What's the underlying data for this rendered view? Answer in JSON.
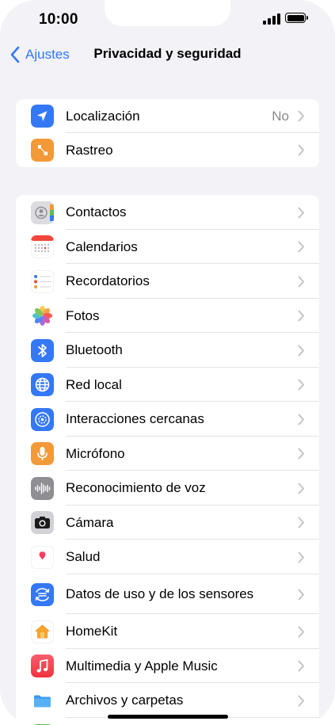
{
  "status_bar": {
    "time": "10:00"
  },
  "nav": {
    "back_label": "Ajustes",
    "title": "Privacidad y seguridad"
  },
  "group1": [
    {
      "label": "Localización",
      "value": "No",
      "icon": "location-arrow-icon",
      "color": "#3478f6"
    },
    {
      "label": "Rastreo",
      "value": "",
      "icon": "tracking-icon",
      "color": "#f19a37"
    }
  ],
  "group2": [
    {
      "label": "Contactos",
      "icon": "contacts-icon",
      "color": "#d9d9de"
    },
    {
      "label": "Calendarios",
      "icon": "calendar-icon",
      "color": "#ffffff"
    },
    {
      "label": "Recordatorios",
      "icon": "reminders-icon",
      "color": "#ffffff"
    },
    {
      "label": "Fotos",
      "icon": "photos-icon",
      "color": "#ffffff"
    },
    {
      "label": "Bluetooth",
      "icon": "bluetooth-icon",
      "color": "#3478f6"
    },
    {
      "label": "Red local",
      "icon": "globe-icon",
      "color": "#3478f6"
    },
    {
      "label": "Interacciones cercanas",
      "icon": "nearby-interactions-icon",
      "color": "#3478f6"
    },
    {
      "label": "Micrófono",
      "icon": "microphone-icon",
      "color": "#f19a37"
    },
    {
      "label": "Reconocimiento de voz",
      "icon": "waveform-icon",
      "color": "#8e8e93"
    },
    {
      "label": "Cámara",
      "icon": "camera-icon",
      "color": "#c7c7cc"
    },
    {
      "label": "Salud",
      "icon": "heart-icon",
      "color": "#ffffff"
    },
    {
      "label": "Datos de uso y de los sensores",
      "icon": "sensor-data-icon",
      "color": "#3478f6"
    },
    {
      "label": "HomeKit",
      "icon": "home-icon",
      "color": "#ffffff"
    },
    {
      "label": "Multimedia y Apple Music",
      "icon": "music-note-icon",
      "color": "#fc3c44"
    },
    {
      "label": "Archivos y carpetas",
      "icon": "folder-icon",
      "color": "#ffffff"
    }
  ]
}
